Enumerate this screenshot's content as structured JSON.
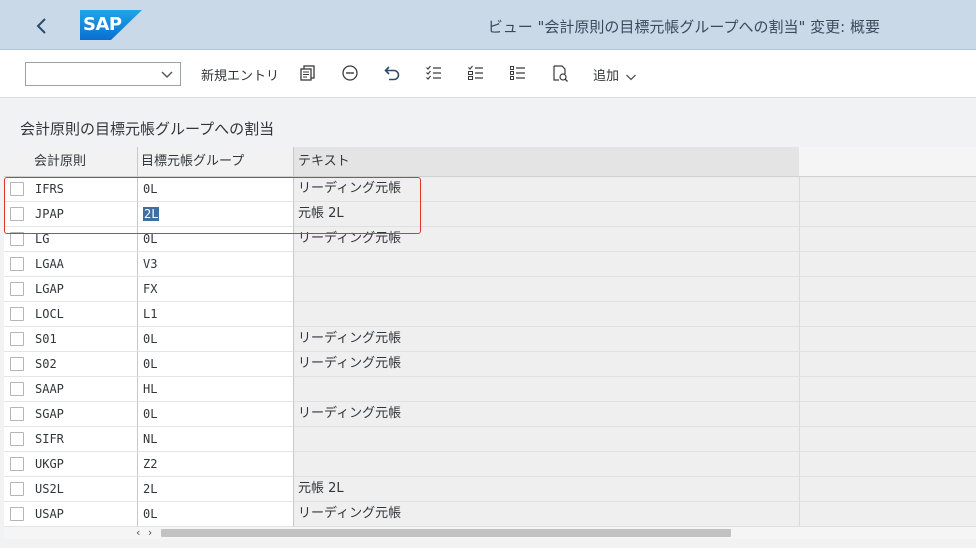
{
  "shell": {
    "logo_text": "SAP",
    "title": "ビュー \"会計原則の目標元帳グループへの割当\" 変更: 概要"
  },
  "toolbar": {
    "dropdown_value": "",
    "new_entry_label": "新規エントリ",
    "add_label": "追加",
    "icons": [
      "copy-icon",
      "delete-icon",
      "undo-icon",
      "select-all-icon",
      "deselect-all-icon",
      "select-block-icon",
      "details-icon"
    ]
  },
  "section": {
    "title": "会計原則の目標元帳グループへの割当"
  },
  "table": {
    "columns": [
      "会計原則",
      "目標元帳グループ",
      "テキスト"
    ],
    "rows": [
      {
        "principle": "IFRS",
        "group": "0L",
        "text": "リーディング元帳"
      },
      {
        "principle": "JPAP",
        "group": "2L",
        "text": "元帳 2L"
      },
      {
        "principle": "LG",
        "group": "0L",
        "text": "リーディング元帳"
      },
      {
        "principle": "LGAA",
        "group": "V3",
        "text": ""
      },
      {
        "principle": "LGAP",
        "group": "FX",
        "text": ""
      },
      {
        "principle": "LOCL",
        "group": "L1",
        "text": ""
      },
      {
        "principle": "S01",
        "group": "0L",
        "text": "リーディング元帳"
      },
      {
        "principle": "S02",
        "group": "0L",
        "text": "リーディング元帳"
      },
      {
        "principle": "SAAP",
        "group": "HL",
        "text": ""
      },
      {
        "principle": "SGAP",
        "group": "0L",
        "text": "リーディング元帳"
      },
      {
        "principle": "SIFR",
        "group": "NL",
        "text": ""
      },
      {
        "principle": "UKGP",
        "group": "Z2",
        "text": ""
      },
      {
        "principle": "US2L",
        "group": "2L",
        "text": "元帳 2L"
      },
      {
        "principle": "USAP",
        "group": "0L",
        "text": "リーディング元帳"
      }
    ]
  },
  "scrollbar": {
    "arrows": "‹ ›"
  },
  "colors": {
    "shell_bg": "#c9d9e8",
    "sap_blue": "#0a6ed1",
    "highlight": "#e0342c",
    "selection": "#3d6fa3"
  }
}
